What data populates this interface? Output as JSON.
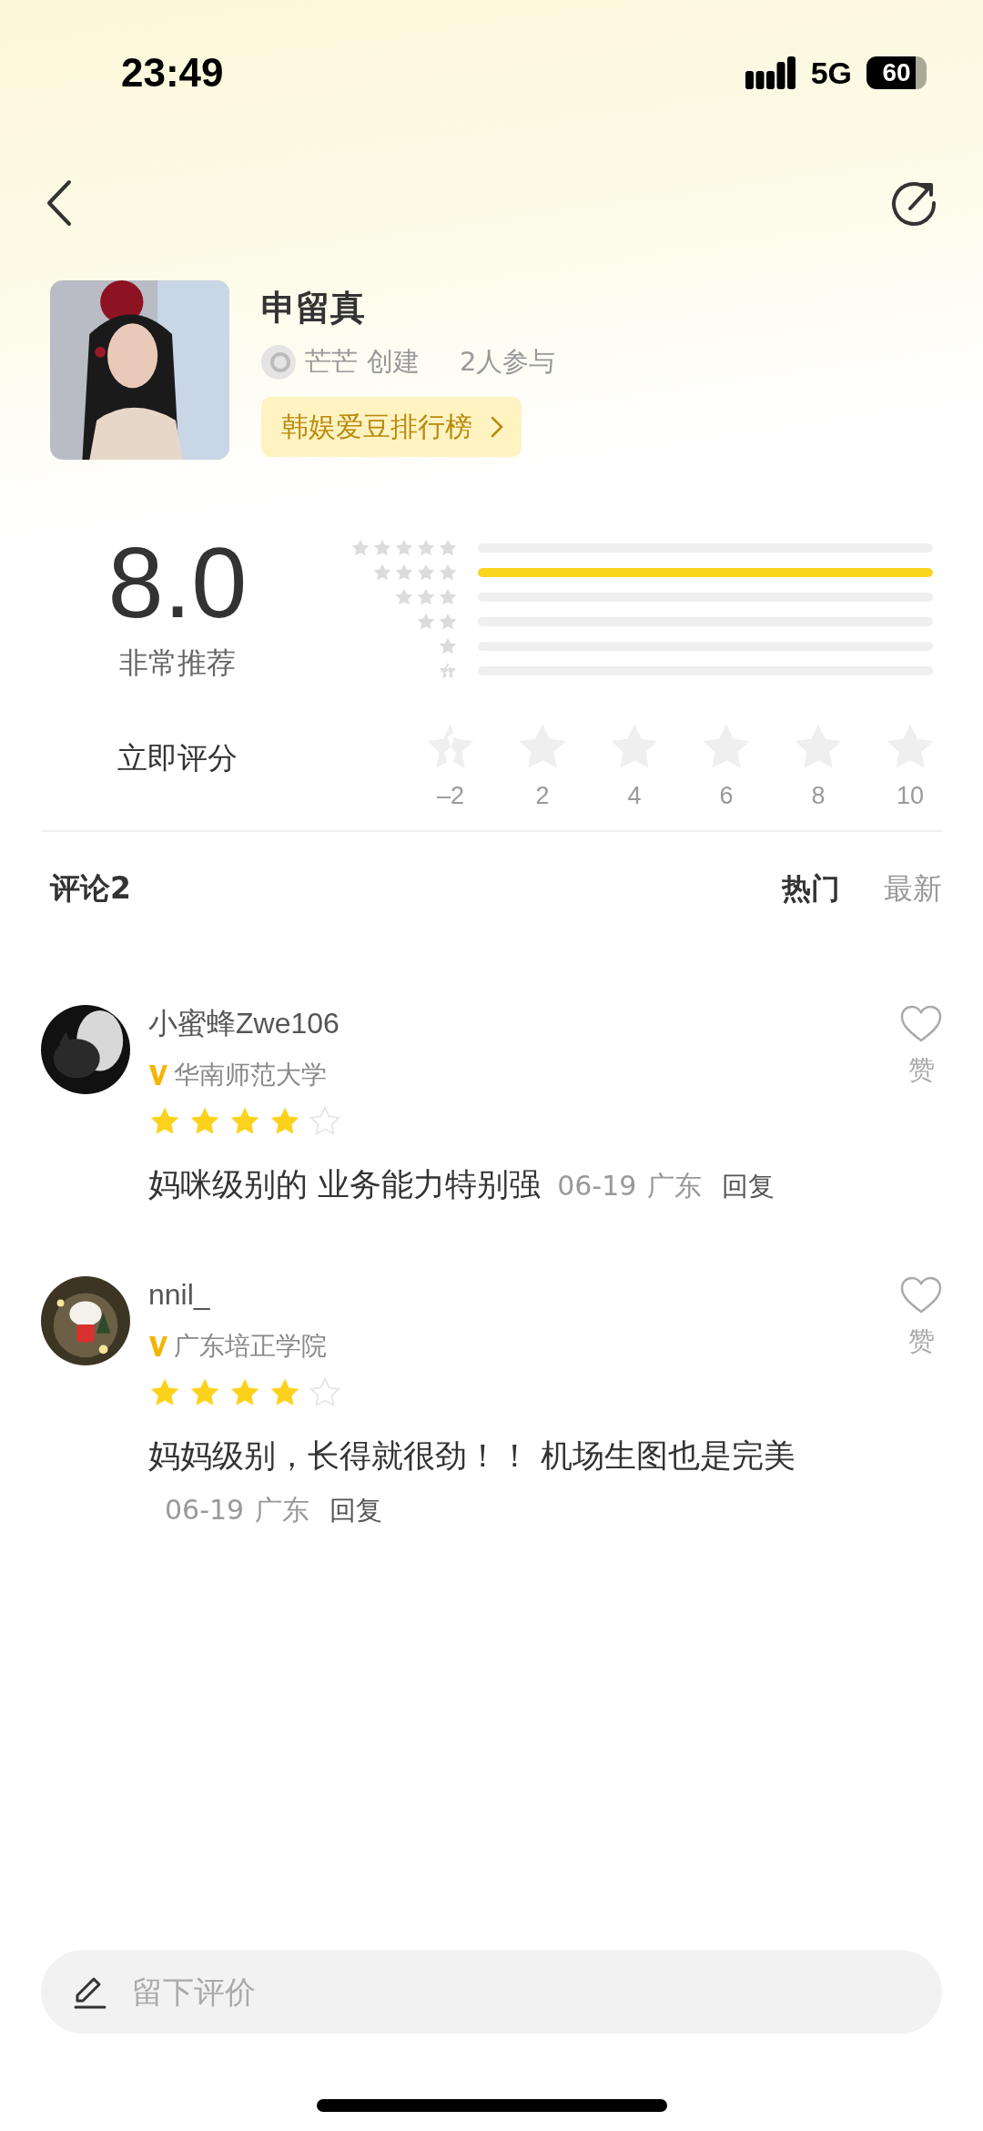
{
  "status_bar": {
    "time": "23:49",
    "network": "5G",
    "battery": "60"
  },
  "header": {
    "title": "申留真",
    "creator": "芒芒",
    "created_label": "创建",
    "participants": "2人参与",
    "tag": "韩娱爱豆排行榜"
  },
  "rating": {
    "score": "8.0",
    "verdict": "非常推荐",
    "distribution": [
      {
        "kind": "five"
      },
      {
        "kind": "four",
        "level": 1
      },
      {
        "kind": "three"
      },
      {
        "kind": "two"
      },
      {
        "kind": "one"
      },
      {
        "kind": "half"
      }
    ]
  },
  "rate_now": {
    "label": "立即评分",
    "options": [
      {
        "kind": "half",
        "label": "–2"
      },
      {
        "kind": "full",
        "label": "2"
      },
      {
        "kind": "full",
        "label": "4"
      },
      {
        "kind": "full",
        "label": "6"
      },
      {
        "kind": "full",
        "label": "8"
      },
      {
        "kind": "full",
        "label": "10"
      }
    ]
  },
  "comments_header": {
    "title": "评论2",
    "sort_tabs": [
      {
        "label": "热门",
        "selected": true
      },
      {
        "label": "最新",
        "selected": false
      }
    ]
  },
  "comments": [
    {
      "user": "小蜜蜂Zwe106",
      "school": "华南师范大学",
      "stars": 4,
      "text": "妈咪级别的 业务能力特别强",
      "date": "06-19",
      "location": "广东",
      "reply": "回复",
      "like": "赞"
    },
    {
      "user": "nnil_",
      "school": "广东培正学院",
      "stars": 4,
      "text": "妈妈级别，长得就很劲！！ 机场生图也是完美",
      "date": "06-19",
      "location": "广东",
      "reply": "回复",
      "like": "赞"
    }
  ],
  "input": {
    "placeholder": "留下评价"
  }
}
